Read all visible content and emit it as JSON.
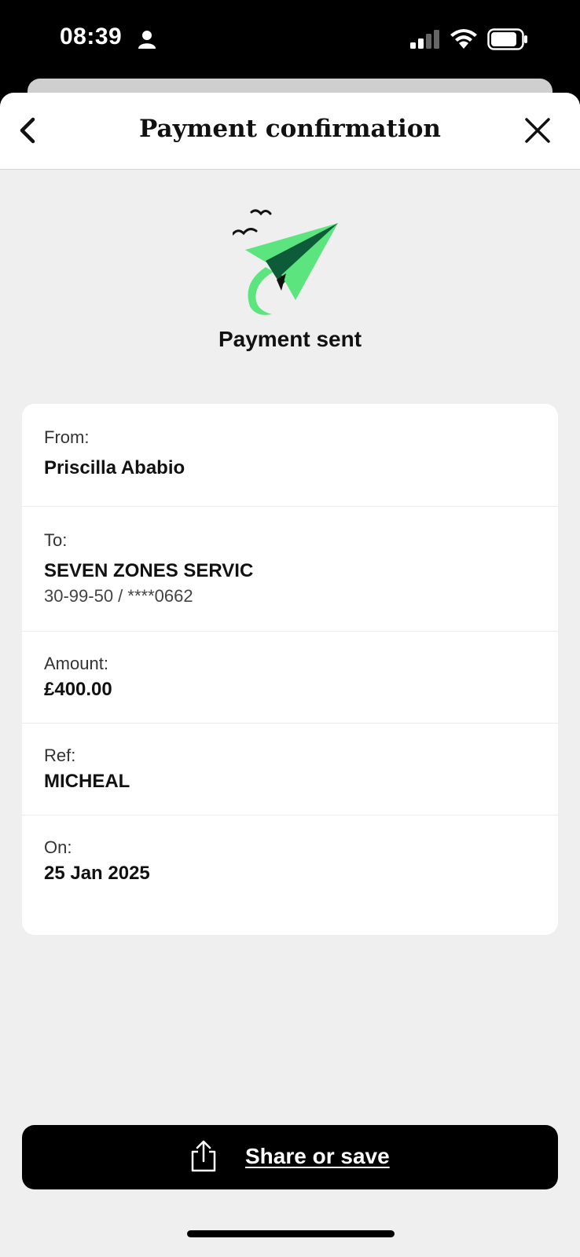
{
  "status_bar": {
    "time": "08:39",
    "icons": [
      "person-icon",
      "cellular-signal-icon",
      "wifi-icon",
      "battery-icon"
    ]
  },
  "header": {
    "title": "Payment confirmation",
    "back_icon": "chevron-left-icon",
    "close_icon": "close-icon"
  },
  "hero": {
    "illustration": "paper-plane-illustration",
    "title": "Payment sent"
  },
  "details": {
    "from": {
      "label": "From:",
      "value": "Priscilla Ababio"
    },
    "to": {
      "label": "To:",
      "value": "SEVEN ZONES SERVIC",
      "account": "30-99-50 / ****0662"
    },
    "amount": {
      "label": "Amount:",
      "value": "£400.00"
    },
    "ref": {
      "label": "Ref:",
      "value": "MICHEAL"
    },
    "on": {
      "label": "On:",
      "value": "25 Jan 2025"
    }
  },
  "actions": {
    "share_label": "Share or save",
    "share_icon": "share-icon"
  },
  "colors": {
    "accent_green": "#5CE57E",
    "dark_green": "#0E5B3A",
    "background": "#EFEFEF",
    "button": "#000000"
  }
}
